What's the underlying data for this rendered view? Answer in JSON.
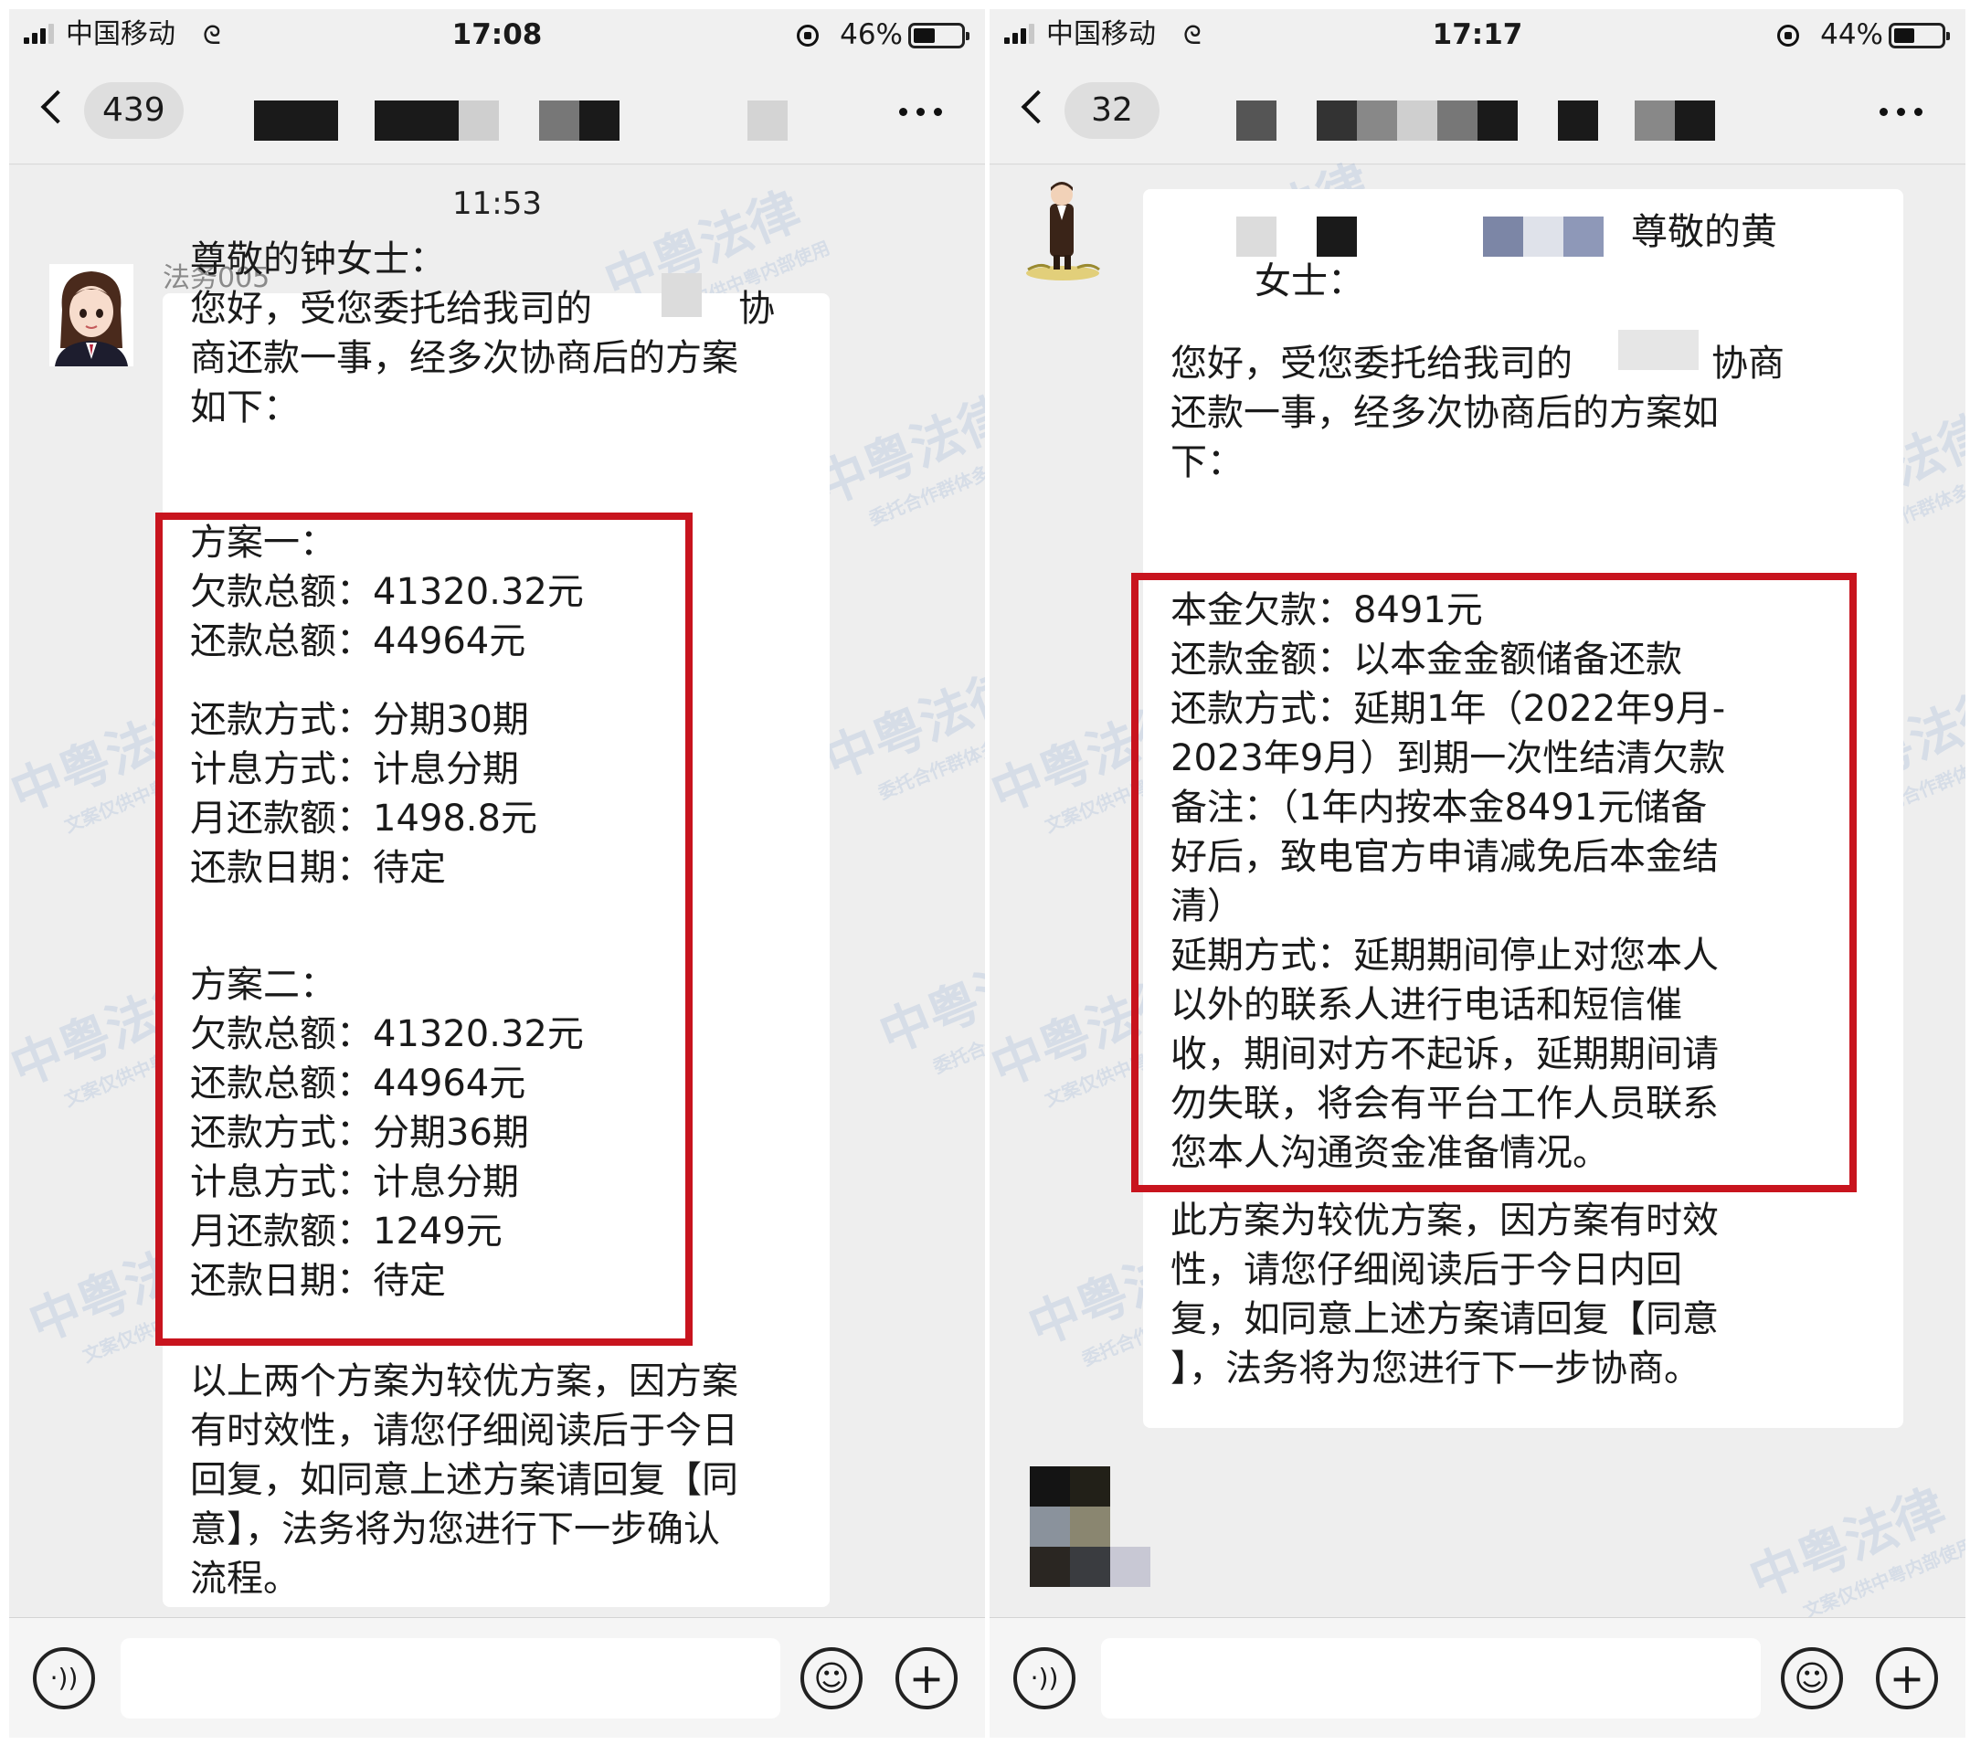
{
  "left": {
    "status": {
      "carrier": "中国移动",
      "link_glyph": "ᘓ",
      "time": "17:08",
      "battery_pct": "46%",
      "battery_level": 0.46
    },
    "header": {
      "unread_count": "439"
    },
    "chat": {
      "timestamp": "11:53",
      "sender_name": "法务005",
      "intro_lines": [
        "尊敬的钟女士：",
        "您好，受您委托给我司的",
        "协",
        "商还款一事，经多次协商后的方案",
        "如下："
      ],
      "plan_lines": [
        "方案一：",
        "欠款总额：41320.32元",
        "还款总额：44964元",
        "",
        "还款方式：分期30期",
        "计息方式：计息分期",
        "月还款额：1498.8元",
        "还款日期：待定",
        "",
        "方案二：",
        "欠款总额：41320.32元",
        "还款总额：44964元",
        "还款方式：分期36期",
        "计息方式：计息分期",
        "月还款额：1249元",
        "还款日期：待定"
      ],
      "closing_lines": [
        "以上两个方案为较优方案，因方案",
        "有时效性，请您仔细阅读后于今日",
        "回复，如同意上述方案请回复【同",
        "意】，法务将为您进行下一步确认",
        "流程。"
      ]
    },
    "watermark": {
      "brand": "中粤法律",
      "line1": "文案仅供中粤内部使用",
      "line2": "委托合作群体多同多核实"
    }
  },
  "right": {
    "status": {
      "carrier": "中国移动",
      "link_glyph": "ᘓ",
      "time": "17:17",
      "battery_pct": "44%",
      "battery_level": 0.44
    },
    "header": {
      "unread_count": "32"
    },
    "chat": {
      "greeting_lines": [
        "尊敬的黄",
        "女士："
      ],
      "intro_lines": [
        "您好，受您委托给我司的",
        "协商",
        "还款一事，经多次协商后的方案如",
        "下："
      ],
      "plan_lines": [
        "本金欠款：8491元",
        "还款金额：以本金金额储备还款",
        "还款方式：延期1年（2022年9月-",
        "2023年9月）到期一次性结清欠款",
        "备注：（1年内按本金8491元储备",
        "好后，致电官方申请减免后本金结",
        "清）",
        "延期方式：延期期间停止对您本人",
        "以外的联系人进行电话和短信催",
        "收，期间对方不起诉，延期期间请",
        "勿失联，将会有平台工作人员联系",
        "您本人沟通资金准备情况。"
      ],
      "closing_lines": [
        "此方案为较优方案，因方案有时效",
        "性，请您仔细阅读后于今日内回",
        "复，如同意上述方案请回复【同意",
        "】，法务将为您进行下一步协商。"
      ]
    },
    "watermark": {
      "brand": "中粤法律",
      "line1": "文案仅供中粤内部使用",
      "line2": "委托合作群体多同多核实"
    }
  },
  "icons": {
    "voice": "voice-input-icon",
    "emoji": "emoji-icon",
    "plus": "plus-icon",
    "back": "back-chevron-icon",
    "more": "more-dots-icon",
    "signal": "signal-icon",
    "battery": "battery-icon",
    "rotation_lock": "rotation-lock-icon"
  },
  "colors": {
    "highlight_box": "#c8141e",
    "watermark": "#2d5fb4",
    "bubble": "#ffffff",
    "chat_bg": "#eeeeee"
  },
  "glyphs": {
    "voice": "·))",
    "emoji": "☺",
    "plus": "+"
  }
}
